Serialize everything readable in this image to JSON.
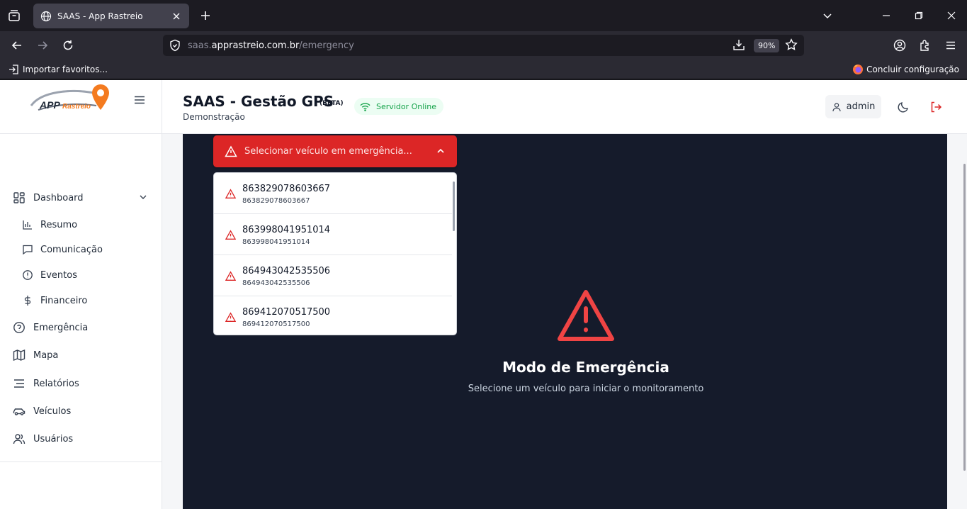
{
  "browser": {
    "tab_title": "SAAS - App Rastreio",
    "url_prefix": "saas.",
    "url_host": "apprastreio.com.br",
    "url_path": "/emergency",
    "zoom": "90%",
    "bookmark_import": "Importar favoritos...",
    "bookmark_setup": "Concluir configuração"
  },
  "brand": {
    "logo_text_1": "APP",
    "logo_text_2": "Rastreio",
    "accent": "#f47b20"
  },
  "sidebar": {
    "dashboard": "Dashboard",
    "resumo": "Resumo",
    "comunicacao": "Comunicação",
    "eventos": "Eventos",
    "financeiro": "Financeiro",
    "emergencia": "Emergência",
    "mapa": "Mapa",
    "relatorios": "Relatórios",
    "veiculos": "Veículos",
    "usuarios": "Usuários"
  },
  "header": {
    "title": "SAAS - Gestão GPS",
    "beta": "(BETA)",
    "subtitle": "Demonstração",
    "status": "Servidor Online",
    "user": "admin"
  },
  "emergency": {
    "select_label": "Selecionar veículo em emergência...",
    "vehicles": [
      {
        "id": "863829078603667",
        "sub": "863829078603667"
      },
      {
        "id": "863998041951014",
        "sub": "863998041951014"
      },
      {
        "id": "864943042535506",
        "sub": "864943042535506"
      },
      {
        "id": "869412070517500",
        "sub": "869412070517500"
      }
    ],
    "title": "Modo de Emergência",
    "subtitle": "Selecione um veículo para iniciar o monitoramento"
  },
  "colors": {
    "danger": "#dc2626",
    "panel_bg": "#151b2b",
    "online": "#16a34a"
  }
}
